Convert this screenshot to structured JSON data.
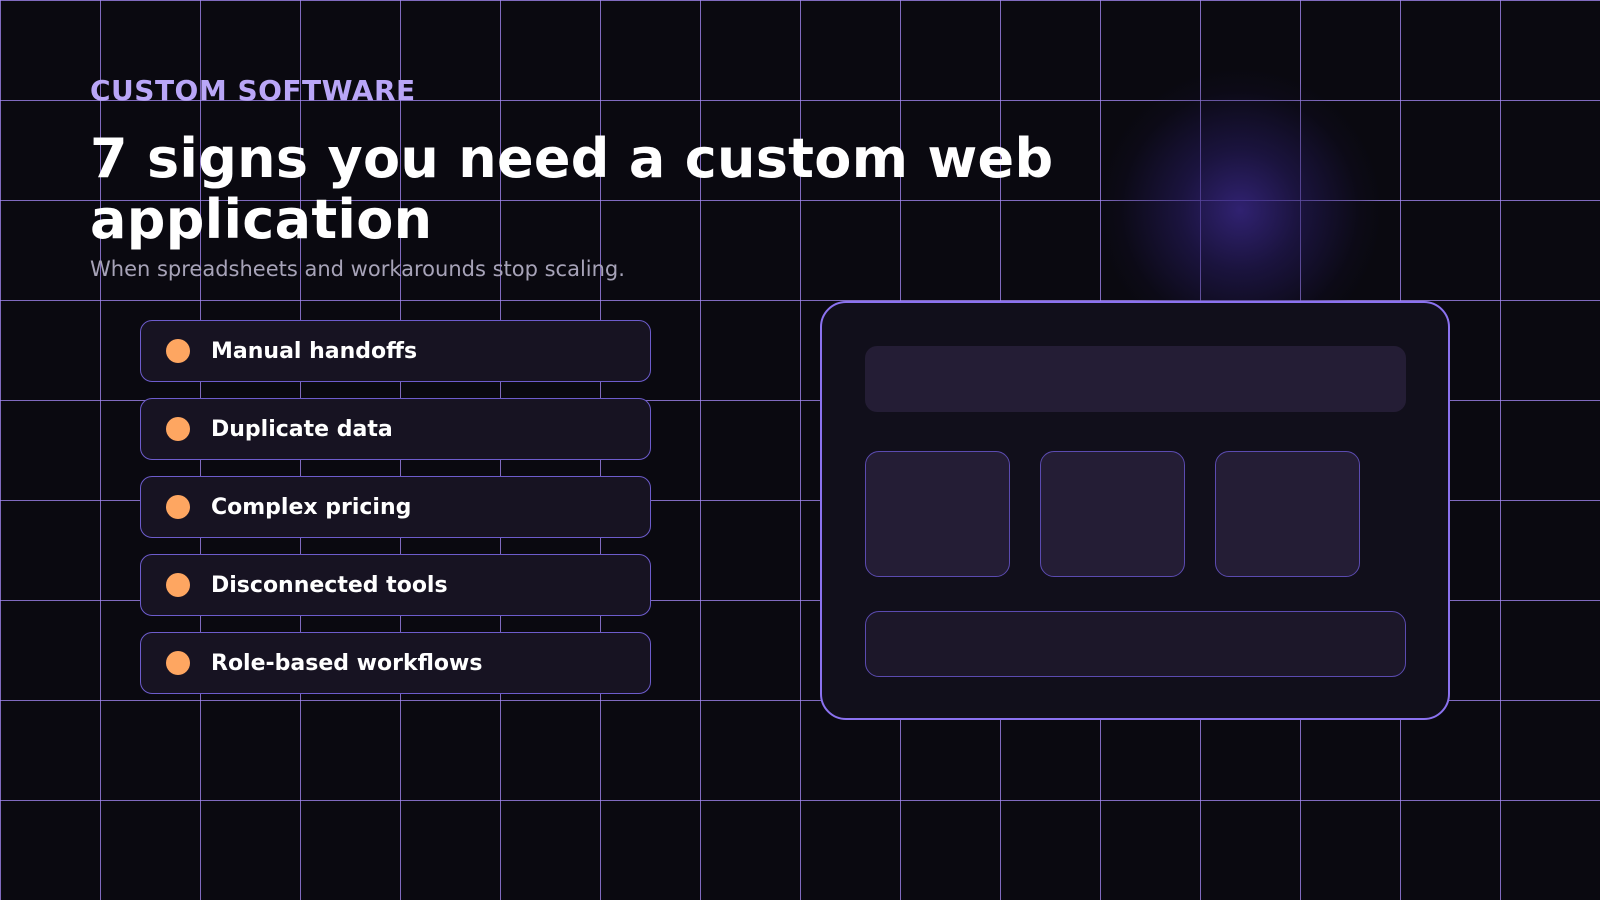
{
  "hero": {
    "eyebrow": "CUSTOM SOFTWARE",
    "title": "7 signs you need a custom web application",
    "subtitle": "When spreadsheets and workarounds stop scaling."
  },
  "signs": [
    {
      "label": "Manual handoffs"
    },
    {
      "label": "Duplicate data"
    },
    {
      "label": "Complex pricing"
    },
    {
      "label": "Disconnected tools"
    },
    {
      "label": "Role-based workflows"
    }
  ],
  "colors": {
    "background": "#0a0910",
    "grid_line": "#a78bfa",
    "eyebrow": "#b9a6f7",
    "bullet": "#fea661",
    "card_border": "#6d5ccc",
    "mock_border": "#8b72f0"
  },
  "icons": {
    "bullet": "orange-dot-icon"
  }
}
